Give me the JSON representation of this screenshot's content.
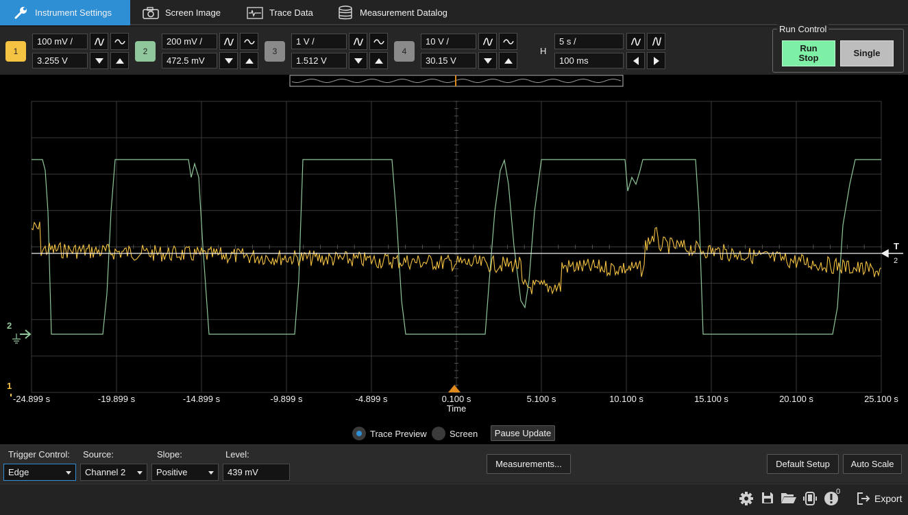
{
  "tabs": [
    {
      "label": "Instrument Settings",
      "icon": "wrench-icon",
      "active": true
    },
    {
      "label": "Screen Image",
      "icon": "camera-icon"
    },
    {
      "label": "Trace Data",
      "icon": "trace-icon"
    },
    {
      "label": "Measurement Datalog",
      "icon": "database-icon"
    }
  ],
  "channels": [
    {
      "num": "1",
      "scale": "100 mV /",
      "offset": "3.255 V",
      "color": "#f5c342"
    },
    {
      "num": "2",
      "scale": "200 mV /",
      "offset": "472.5 mV",
      "color": "#8fc79a"
    },
    {
      "num": "3",
      "scale": "1 V /",
      "offset": "1.512 V",
      "color": "#8a8a8a"
    },
    {
      "num": "4",
      "scale": "10 V /",
      "offset": "30.15 V",
      "color": "#8a8a8a"
    }
  ],
  "horizontal": {
    "label": "H",
    "scale": "5 s /",
    "position": "100 ms"
  },
  "run_control": {
    "label": "Run Control",
    "run_stop": "Run\nStop",
    "single": "Single",
    "run_color": "#7ef0a6",
    "single_color": "#bdbdbd"
  },
  "scope": {
    "x_tick_labels": [
      "-24.899 s",
      "-19.899 s",
      "-14.899 s",
      "-9.899 s",
      "-4.899 s",
      "0.100 s",
      "5.100 s",
      "10.100 s",
      "15.100 s",
      "20.100 s",
      "25.100 s"
    ],
    "x_axis_title": "Time",
    "trigger_marker": "T",
    "trigger_channel": "2",
    "ch2_ground_label": "2",
    "ch1_marker_label": "1"
  },
  "preview": {
    "trace_preview": "Trace Preview",
    "screen": "Screen",
    "pause": "Pause Update",
    "selected": "Trace Preview"
  },
  "trigger": {
    "control_label": "Trigger Control:",
    "control_value": "Edge",
    "source_label": "Source:",
    "source_value": "Channel 2",
    "slope_label": "Slope:",
    "slope_value": "Positive",
    "level_label": "Level:",
    "level_value": "439 mV"
  },
  "buttons": {
    "measurements": "Measurements...",
    "default_setup": "Default Setup",
    "auto_scale": "Auto Scale"
  },
  "statusbar": {
    "alert_count": "0",
    "export": "Export"
  }
}
